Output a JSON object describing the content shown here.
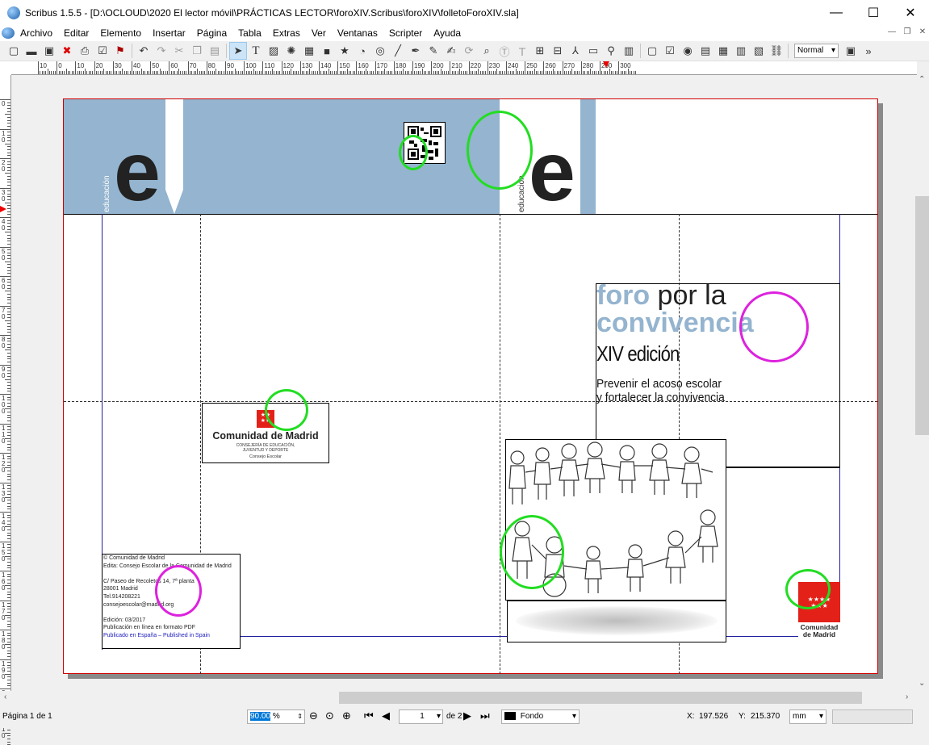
{
  "window": {
    "title": "Scribus 1.5.5 - [D:\\OCLOUD\\2020 El lector móvil\\PRÁCTICAS LECTOR\\foroXIV.Scribus\\foroXIV\\folletoForoXIV.sla]",
    "controls": [
      "—",
      "☐",
      "✕"
    ]
  },
  "menu": [
    "Archivo",
    "Editar",
    "Elemento",
    "Insertar",
    "Página",
    "Tabla",
    "Extras",
    "Ver",
    "Ventanas",
    "Scripter",
    "Ayuda"
  ],
  "toolbar": {
    "mode_select": "Normal",
    "icons": [
      "new-icon",
      "open-icon",
      "save-icon",
      "close-doc-icon",
      "print-icon",
      "preflight-icon",
      "pdf-icon",
      "undo-icon",
      "redo-icon",
      "cut-icon",
      "copy-icon",
      "paste-icon",
      "select-icon",
      "text-frame-icon",
      "image-frame-icon",
      "render-frame-icon",
      "table-icon",
      "shape-icon",
      "polygon-icon",
      "arc-icon",
      "spiral-icon",
      "line-icon",
      "bezier-icon",
      "freehand-icon",
      "calligraphic-icon",
      "rotate-icon",
      "zoom-icon",
      "edit-text-icon",
      "story-editor-icon",
      "link-frames-icon",
      "unlink-frames-icon",
      "measure-icon",
      "copy-props-icon",
      "eyedropper-icon",
      "barcode-icon",
      "pdf-button-icon",
      "pdf-checkbox-icon",
      "pdf-radio-icon",
      "pdf-textfield-icon",
      "pdf-combo-icon",
      "pdf-list-icon",
      "pdf-annotation-icon",
      "pdf-link-icon"
    ]
  },
  "ruler": {
    "h_labels": [
      "10",
      "0",
      "10",
      "20",
      "30",
      "40",
      "50",
      "60",
      "70",
      "80",
      "90",
      "100",
      "110",
      "120",
      "130",
      "140",
      "150",
      "160",
      "170",
      "180",
      "190",
      "200",
      "210",
      "220",
      "230",
      "240",
      "250",
      "260",
      "270",
      "280",
      "290",
      "300"
    ],
    "v_labels": [
      "0",
      "10",
      "20",
      "30",
      "40",
      "50",
      "60",
      "70",
      "80",
      "90",
      "100",
      "110",
      "120",
      "130",
      "140",
      "150",
      "160",
      "170",
      "180",
      "190",
      "200",
      "210"
    ]
  },
  "document": {
    "banner_color": "#94b4cf",
    "brand_left": "educación",
    "brand_right": "educación",
    "title_foro": "foro",
    "title_porla": "por la",
    "title_convivencia": "convivencia",
    "title_edicion": "XIV edición",
    "subtitle_line1": "Prevenir  el acoso escolar",
    "subtitle_line2": "y fortalecer la convivencia",
    "logo_cm_title": "Comunidad de Madrid",
    "logo_cm_sub1": "CONSEJERÍA DE EDUCACIÓN,",
    "logo_cm_sub2": "JUVENTUD Y DEPORTE",
    "logo_cm_sub3": "Consejo Escolar",
    "imprint": [
      "© Comunidad de Madrid",
      "Edita: Consejo Escolar de la Comunidad de Madrid",
      "",
      "C/ Paseo de Recoletos 14, 7ª planta",
      "28001 Madrid",
      "Tel.914208221",
      "consejoescolar@madrid.org",
      "",
      "Edición: 03/2017",
      "Publicación en línea en formato PDF",
      "Publicado en España – Published in Spain"
    ],
    "small_logo_line1": "Comunidad",
    "small_logo_line2": "de Madrid"
  },
  "status": {
    "page_label": "Página 1 de 1",
    "zoom": "90.00",
    "zoom_unit": "%",
    "page_number": "1",
    "page_of": "de 2",
    "layer": "Fondo",
    "x_label": "X:",
    "x_value": "197.526",
    "y_label": "Y:",
    "y_value": "215.370",
    "unit": "mm"
  },
  "colors": {
    "accent_green": "#22dd22",
    "accent_magenta": "#dd22dd",
    "madrid_red": "#e32119"
  }
}
